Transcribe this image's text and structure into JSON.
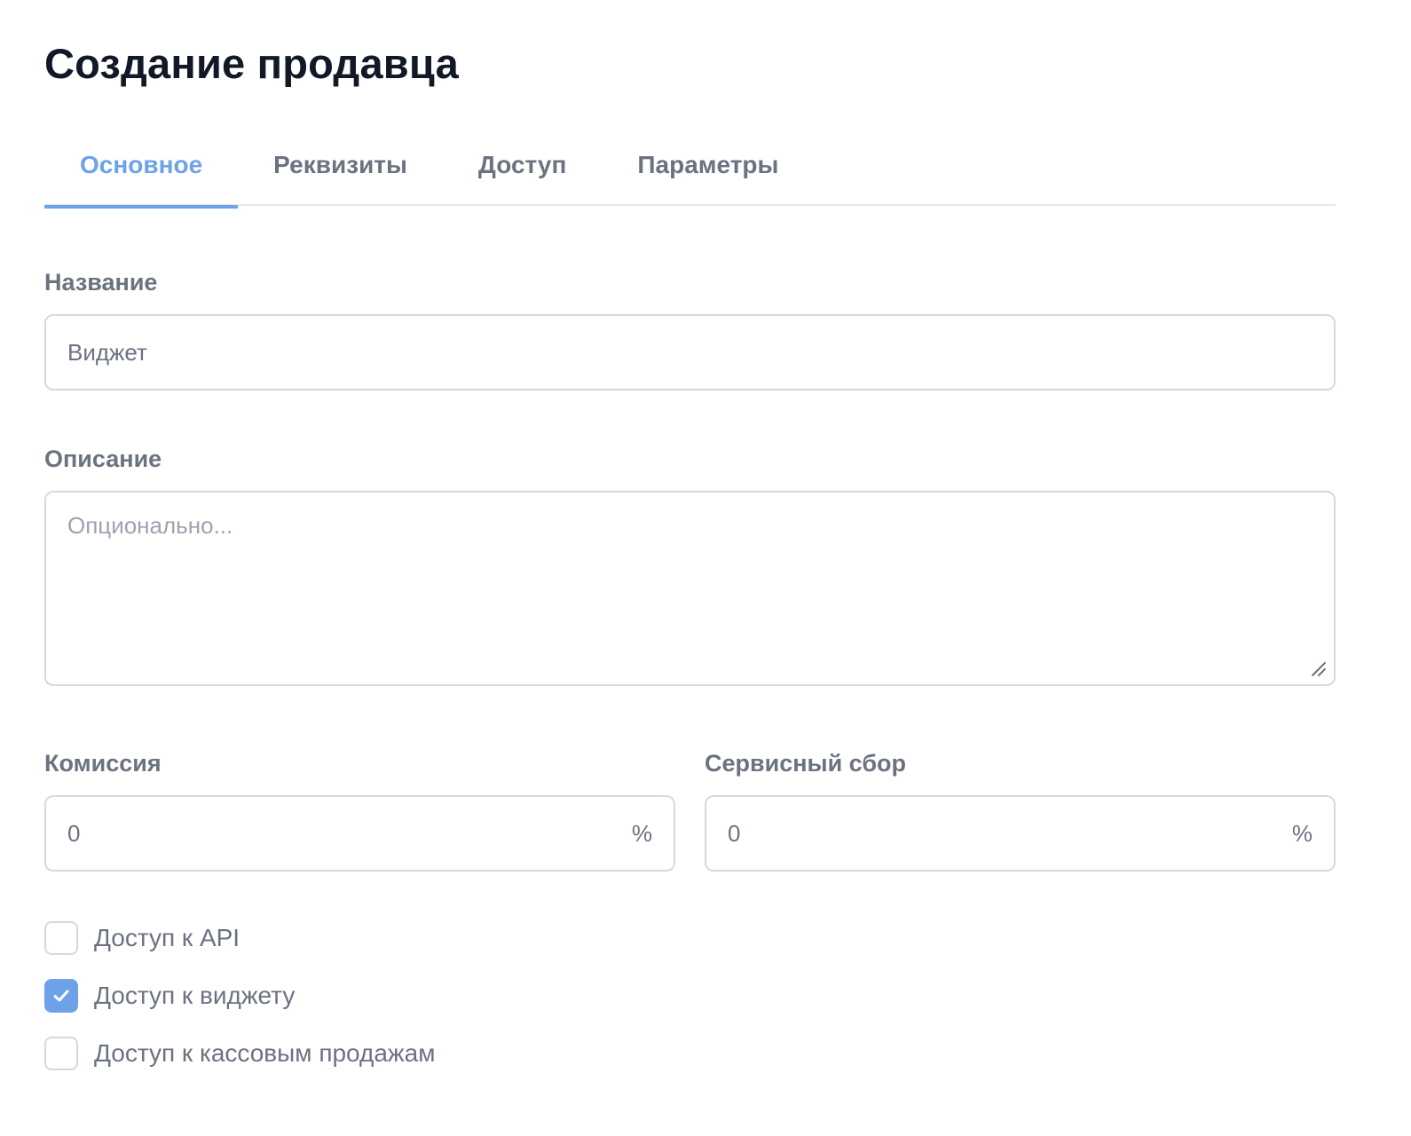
{
  "page": {
    "title": "Создание продавца"
  },
  "tabs": [
    {
      "label": "Основное",
      "active": true
    },
    {
      "label": "Реквизиты",
      "active": false
    },
    {
      "label": "Доступ",
      "active": false
    },
    {
      "label": "Параметры",
      "active": false
    }
  ],
  "form": {
    "name": {
      "label": "Название",
      "value": "Виджет"
    },
    "description": {
      "label": "Описание",
      "value": "",
      "placeholder": "Опционально..."
    },
    "commission": {
      "label": "Комиссия",
      "value": "0",
      "suffix": "%"
    },
    "service_fee": {
      "label": "Сервисный сбор",
      "value": "0",
      "suffix": "%"
    },
    "checkboxes": [
      {
        "label": "Доступ к API",
        "checked": false
      },
      {
        "label": "Доступ к виджету",
        "checked": true
      },
      {
        "label": "Доступ к кассовым продажам",
        "checked": false
      }
    ]
  },
  "colors": {
    "accent": "#6ea2e8",
    "text": "#6b7280",
    "title": "#111827",
    "border": "#d6d9de"
  }
}
